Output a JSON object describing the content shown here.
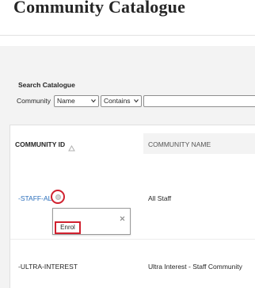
{
  "page": {
    "title": "Community Catalogue"
  },
  "search": {
    "heading": "Search Catalogue",
    "field_label": "Community",
    "field_select_value": "Name",
    "operator_select_value": "Contains",
    "query_value": ""
  },
  "table": {
    "columns": {
      "id": "COMMUNITY ID",
      "name": "COMMUNITY NAME"
    },
    "sort_icon": "triangle-up-icon",
    "rows": [
      {
        "id": "-STAFF-AL",
        "name": "All Staff"
      },
      {
        "id": "-ULTRA-INTEREST",
        "name": "Ultra Interest - Staff Community"
      }
    ]
  },
  "row_menu": {
    "icon": "options-circle-icon",
    "close_icon": "close-icon",
    "enrol_label": "Enrol"
  },
  "colors": {
    "link": "#2a6ebb",
    "highlight": "#d0212f",
    "header_bg": "#f3f3f3"
  }
}
